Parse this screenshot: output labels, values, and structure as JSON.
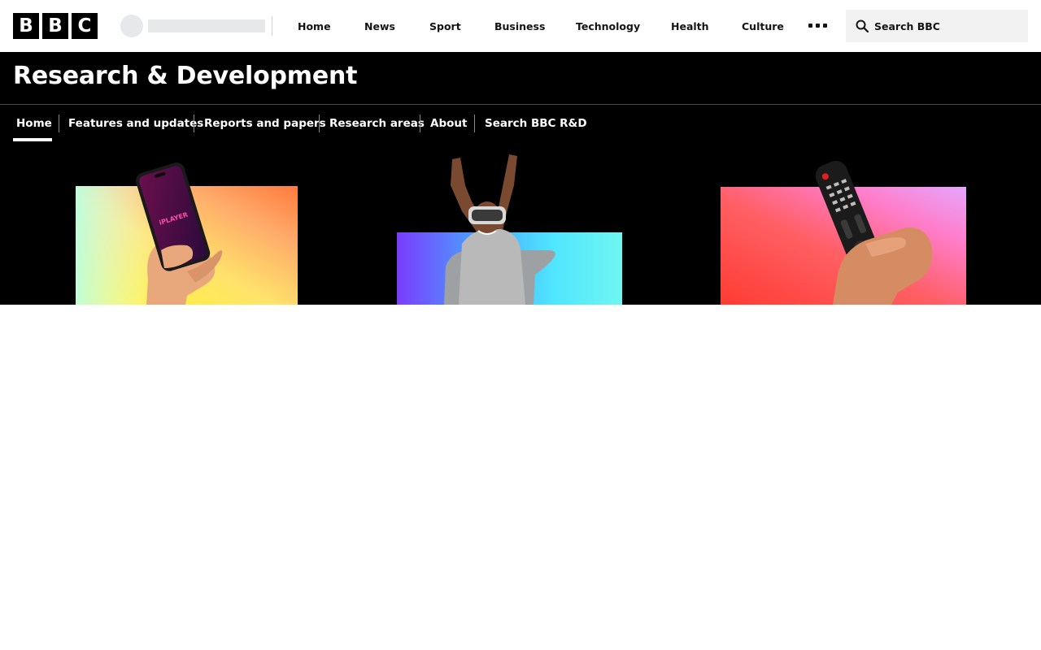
{
  "global_header": {
    "logo_letters": [
      "B",
      "B",
      "C"
    ],
    "nav_items": [
      {
        "label": "Home"
      },
      {
        "label": "News"
      },
      {
        "label": "Sport"
      },
      {
        "label": "Business"
      },
      {
        "label": "Technology"
      },
      {
        "label": "Health"
      },
      {
        "label": "Culture"
      }
    ],
    "more_icon": "ellipsis-icon",
    "search": {
      "placeholder": "Search BBC",
      "icon": "search-icon"
    }
  },
  "masthead": {
    "title": "Research & Development",
    "sub_nav": [
      {
        "label": "Home",
        "active": true
      },
      {
        "label": "Features and updates"
      },
      {
        "label": "Reports and papers"
      },
      {
        "label": "Research areas"
      },
      {
        "label": "About"
      },
      {
        "label": "Search BBC R&D"
      }
    ]
  },
  "promos": [
    {
      "subject": "hand-holding-phone",
      "phone_text": "iPLAYER"
    },
    {
      "subject": "person-with-vr-headset"
    },
    {
      "subject": "hand-holding-tv-remote"
    }
  ],
  "colors": {
    "header_bg": "#ffffff",
    "masthead_bg": "#000000",
    "text_dark": "#141414",
    "search_bg": "#f2f2f2",
    "placeholder_grey": "#e6e8ea"
  }
}
